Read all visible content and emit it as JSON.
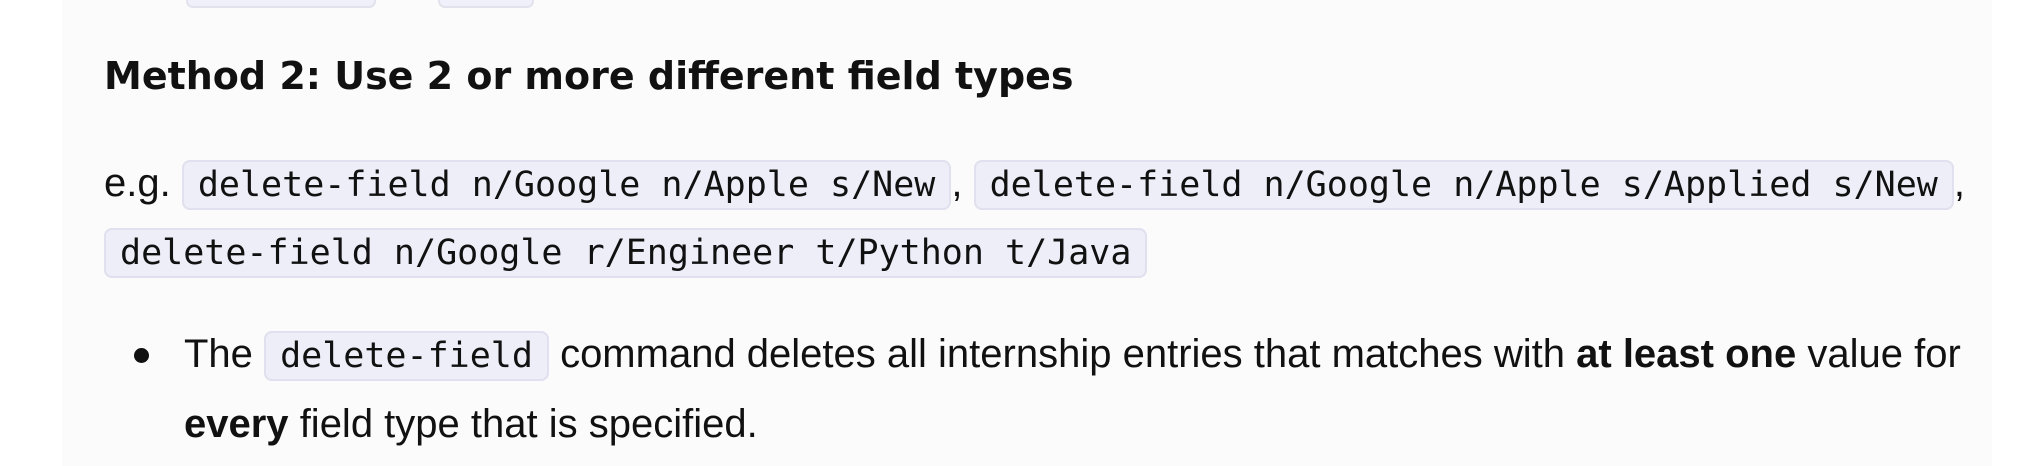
{
  "section": {
    "heading": "Method 2: Use 2 or more different field types",
    "example": {
      "prefix": "e.g.",
      "separator": ",",
      "commands": [
        "delete-field n/Google n/Apple s/New",
        "delete-field n/Google n/Apple s/Applied s/New",
        "delete-field n/Google r/Engineer t/Python t/Java"
      ]
    },
    "bullet": {
      "part1": "The",
      "code": "delete-field",
      "part2": "command deletes all internship entries that matches with",
      "bold1": "at least one",
      "part3": "value for",
      "bold2": "every",
      "part4": "field type that is specified."
    }
  },
  "colors": {
    "code_background": "#eeeef9",
    "code_border": "#e0e0ee",
    "panel_background": "#fbfbfc",
    "text": "#111111"
  }
}
